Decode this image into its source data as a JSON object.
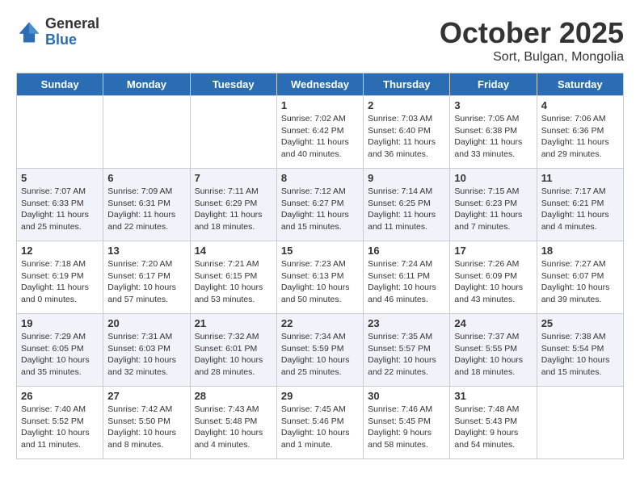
{
  "header": {
    "logo_general": "General",
    "logo_blue": "Blue",
    "month_title": "October 2025",
    "location": "Sort, Bulgan, Mongolia"
  },
  "days_of_week": [
    "Sunday",
    "Monday",
    "Tuesday",
    "Wednesday",
    "Thursday",
    "Friday",
    "Saturday"
  ],
  "weeks": [
    [
      {
        "day": "",
        "sunrise": "",
        "sunset": "",
        "daylight": ""
      },
      {
        "day": "",
        "sunrise": "",
        "sunset": "",
        "daylight": ""
      },
      {
        "day": "",
        "sunrise": "",
        "sunset": "",
        "daylight": ""
      },
      {
        "day": "1",
        "sunrise": "Sunrise: 7:02 AM",
        "sunset": "Sunset: 6:42 PM",
        "daylight": "Daylight: 11 hours and 40 minutes."
      },
      {
        "day": "2",
        "sunrise": "Sunrise: 7:03 AM",
        "sunset": "Sunset: 6:40 PM",
        "daylight": "Daylight: 11 hours and 36 minutes."
      },
      {
        "day": "3",
        "sunrise": "Sunrise: 7:05 AM",
        "sunset": "Sunset: 6:38 PM",
        "daylight": "Daylight: 11 hours and 33 minutes."
      },
      {
        "day": "4",
        "sunrise": "Sunrise: 7:06 AM",
        "sunset": "Sunset: 6:36 PM",
        "daylight": "Daylight: 11 hours and 29 minutes."
      }
    ],
    [
      {
        "day": "5",
        "sunrise": "Sunrise: 7:07 AM",
        "sunset": "Sunset: 6:33 PM",
        "daylight": "Daylight: 11 hours and 25 minutes."
      },
      {
        "day": "6",
        "sunrise": "Sunrise: 7:09 AM",
        "sunset": "Sunset: 6:31 PM",
        "daylight": "Daylight: 11 hours and 22 minutes."
      },
      {
        "day": "7",
        "sunrise": "Sunrise: 7:11 AM",
        "sunset": "Sunset: 6:29 PM",
        "daylight": "Daylight: 11 hours and 18 minutes."
      },
      {
        "day": "8",
        "sunrise": "Sunrise: 7:12 AM",
        "sunset": "Sunset: 6:27 PM",
        "daylight": "Daylight: 11 hours and 15 minutes."
      },
      {
        "day": "9",
        "sunrise": "Sunrise: 7:14 AM",
        "sunset": "Sunset: 6:25 PM",
        "daylight": "Daylight: 11 hours and 11 minutes."
      },
      {
        "day": "10",
        "sunrise": "Sunrise: 7:15 AM",
        "sunset": "Sunset: 6:23 PM",
        "daylight": "Daylight: 11 hours and 7 minutes."
      },
      {
        "day": "11",
        "sunrise": "Sunrise: 7:17 AM",
        "sunset": "Sunset: 6:21 PM",
        "daylight": "Daylight: 11 hours and 4 minutes."
      }
    ],
    [
      {
        "day": "12",
        "sunrise": "Sunrise: 7:18 AM",
        "sunset": "Sunset: 6:19 PM",
        "daylight": "Daylight: 11 hours and 0 minutes."
      },
      {
        "day": "13",
        "sunrise": "Sunrise: 7:20 AM",
        "sunset": "Sunset: 6:17 PM",
        "daylight": "Daylight: 10 hours and 57 minutes."
      },
      {
        "day": "14",
        "sunrise": "Sunrise: 7:21 AM",
        "sunset": "Sunset: 6:15 PM",
        "daylight": "Daylight: 10 hours and 53 minutes."
      },
      {
        "day": "15",
        "sunrise": "Sunrise: 7:23 AM",
        "sunset": "Sunset: 6:13 PM",
        "daylight": "Daylight: 10 hours and 50 minutes."
      },
      {
        "day": "16",
        "sunrise": "Sunrise: 7:24 AM",
        "sunset": "Sunset: 6:11 PM",
        "daylight": "Daylight: 10 hours and 46 minutes."
      },
      {
        "day": "17",
        "sunrise": "Sunrise: 7:26 AM",
        "sunset": "Sunset: 6:09 PM",
        "daylight": "Daylight: 10 hours and 43 minutes."
      },
      {
        "day": "18",
        "sunrise": "Sunrise: 7:27 AM",
        "sunset": "Sunset: 6:07 PM",
        "daylight": "Daylight: 10 hours and 39 minutes."
      }
    ],
    [
      {
        "day": "19",
        "sunrise": "Sunrise: 7:29 AM",
        "sunset": "Sunset: 6:05 PM",
        "daylight": "Daylight: 10 hours and 35 minutes."
      },
      {
        "day": "20",
        "sunrise": "Sunrise: 7:31 AM",
        "sunset": "Sunset: 6:03 PM",
        "daylight": "Daylight: 10 hours and 32 minutes."
      },
      {
        "day": "21",
        "sunrise": "Sunrise: 7:32 AM",
        "sunset": "Sunset: 6:01 PM",
        "daylight": "Daylight: 10 hours and 28 minutes."
      },
      {
        "day": "22",
        "sunrise": "Sunrise: 7:34 AM",
        "sunset": "Sunset: 5:59 PM",
        "daylight": "Daylight: 10 hours and 25 minutes."
      },
      {
        "day": "23",
        "sunrise": "Sunrise: 7:35 AM",
        "sunset": "Sunset: 5:57 PM",
        "daylight": "Daylight: 10 hours and 22 minutes."
      },
      {
        "day": "24",
        "sunrise": "Sunrise: 7:37 AM",
        "sunset": "Sunset: 5:55 PM",
        "daylight": "Daylight: 10 hours and 18 minutes."
      },
      {
        "day": "25",
        "sunrise": "Sunrise: 7:38 AM",
        "sunset": "Sunset: 5:54 PM",
        "daylight": "Daylight: 10 hours and 15 minutes."
      }
    ],
    [
      {
        "day": "26",
        "sunrise": "Sunrise: 7:40 AM",
        "sunset": "Sunset: 5:52 PM",
        "daylight": "Daylight: 10 hours and 11 minutes."
      },
      {
        "day": "27",
        "sunrise": "Sunrise: 7:42 AM",
        "sunset": "Sunset: 5:50 PM",
        "daylight": "Daylight: 10 hours and 8 minutes."
      },
      {
        "day": "28",
        "sunrise": "Sunrise: 7:43 AM",
        "sunset": "Sunset: 5:48 PM",
        "daylight": "Daylight: 10 hours and 4 minutes."
      },
      {
        "day": "29",
        "sunrise": "Sunrise: 7:45 AM",
        "sunset": "Sunset: 5:46 PM",
        "daylight": "Daylight: 10 hours and 1 minute."
      },
      {
        "day": "30",
        "sunrise": "Sunrise: 7:46 AM",
        "sunset": "Sunset: 5:45 PM",
        "daylight": "Daylight: 9 hours and 58 minutes."
      },
      {
        "day": "31",
        "sunrise": "Sunrise: 7:48 AM",
        "sunset": "Sunset: 5:43 PM",
        "daylight": "Daylight: 9 hours and 54 minutes."
      },
      {
        "day": "",
        "sunrise": "",
        "sunset": "",
        "daylight": ""
      }
    ]
  ]
}
